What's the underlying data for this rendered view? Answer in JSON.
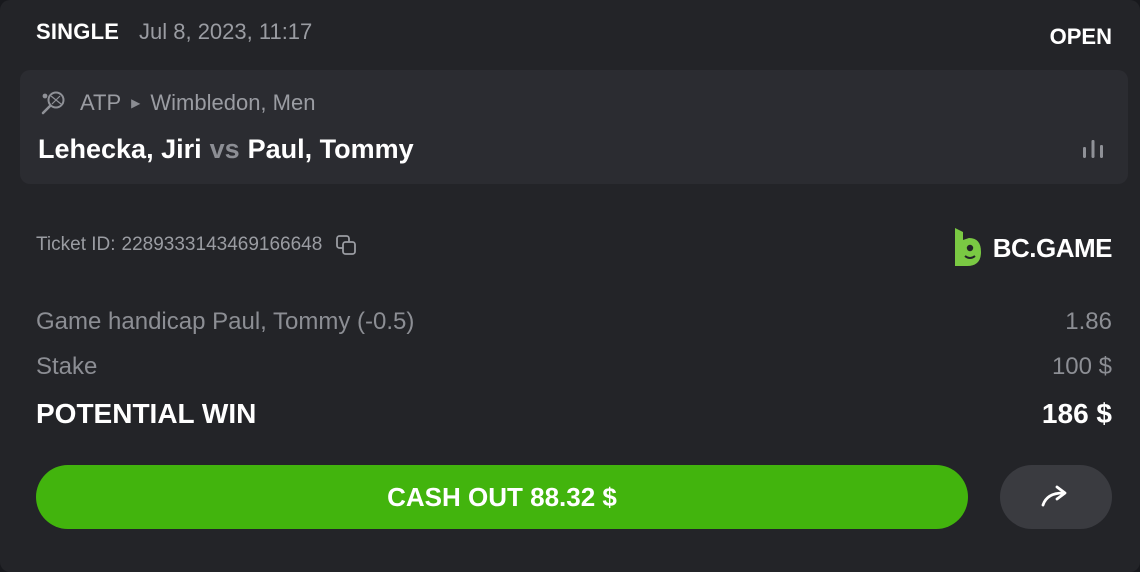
{
  "header": {
    "bet_type": "SINGLE",
    "date": "Jul 8, 2023, 11:17",
    "status": "OPEN"
  },
  "event": {
    "sport_icon": "tennis-racket-icon",
    "league": "ATP",
    "tournament": "Wimbledon, Men",
    "home": "Lehecka, Jiri",
    "vs": "vs",
    "away": "Paul, Tommy",
    "stats_icon": "bar-chart-icon"
  },
  "ticket": {
    "label": "Ticket ID:",
    "id": "2289333143469166648",
    "copy_icon": "copy-icon"
  },
  "brand": {
    "name": "BC.GAME",
    "color": "#7ac943"
  },
  "selection": {
    "market": "Game handicap Paul, Tommy (-0.5)",
    "odds": "1.86"
  },
  "stake": {
    "label": "Stake",
    "value": "100 $"
  },
  "potential_win": {
    "label": "POTENTIAL WIN",
    "value": "186 $"
  },
  "actions": {
    "cashout_label": "CASH OUT 88.32 $",
    "cashout_color": "#42b40d",
    "share_icon": "share-arrow-icon"
  }
}
